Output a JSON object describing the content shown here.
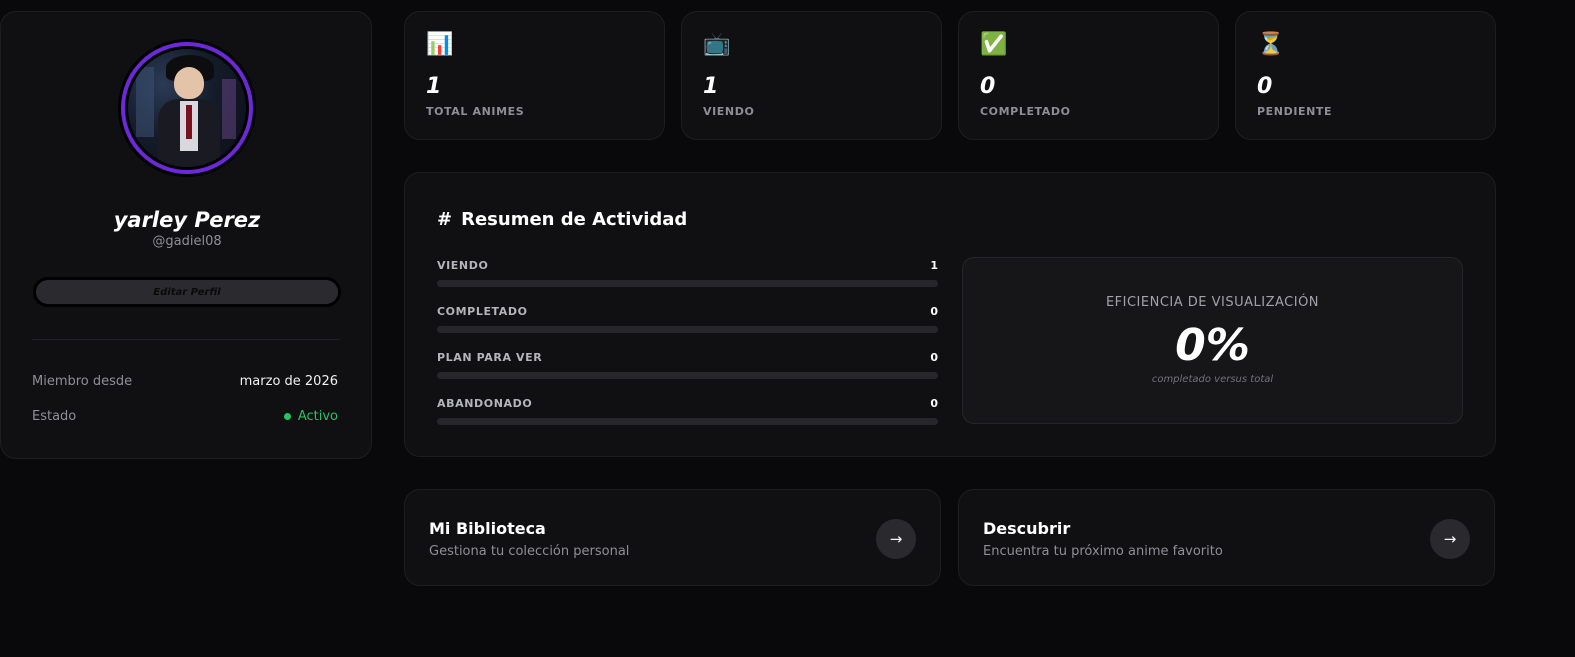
{
  "profile": {
    "name": "yarley Perez",
    "handle": "@gadiel08",
    "edit_label": "Editar Perfil",
    "member_label": "Miembro desde",
    "member_value": "marzo de 2026",
    "status_label": "Estado",
    "status_value": "Activo",
    "status_color": "#22c55e",
    "avatar_ring_color": "#6d28d9"
  },
  "stats": [
    {
      "icon": "📊",
      "icon_name": "bar-chart-icon",
      "value": "1",
      "label": "TOTAL ANIMES"
    },
    {
      "icon": "📺",
      "icon_name": "tv-icon",
      "value": "1",
      "label": "VIENDO"
    },
    {
      "icon": "✅",
      "icon_name": "check-mark-icon",
      "value": "0",
      "label": "COMPLETADO"
    },
    {
      "icon": "⏳",
      "icon_name": "hourglass-icon",
      "value": "0",
      "label": "PENDIENTE"
    }
  ],
  "activity": {
    "hash": "#",
    "title": "Resumen de Actividad",
    "bars": [
      {
        "label": "VIENDO",
        "count": "1",
        "fraction": 0
      },
      {
        "label": "COMPLETADO",
        "count": "0",
        "fraction": 0
      },
      {
        "label": "PLAN PARA VER",
        "count": "0",
        "fraction": 0
      },
      {
        "label": "ABANDONADO",
        "count": "0",
        "fraction": 0
      }
    ],
    "efficiency": {
      "title": "EFICIENCIA DE VISUALIZACIÓN",
      "value": "0%",
      "subtitle": "completado versus total"
    }
  },
  "nav": [
    {
      "title": "Mi Biblioteca",
      "subtitle": "Gestiona tu colección personal",
      "arrow": "→"
    },
    {
      "title": "Descubrir",
      "subtitle": "Encuentra tu próximo anime favorito",
      "arrow": "→"
    }
  ]
}
